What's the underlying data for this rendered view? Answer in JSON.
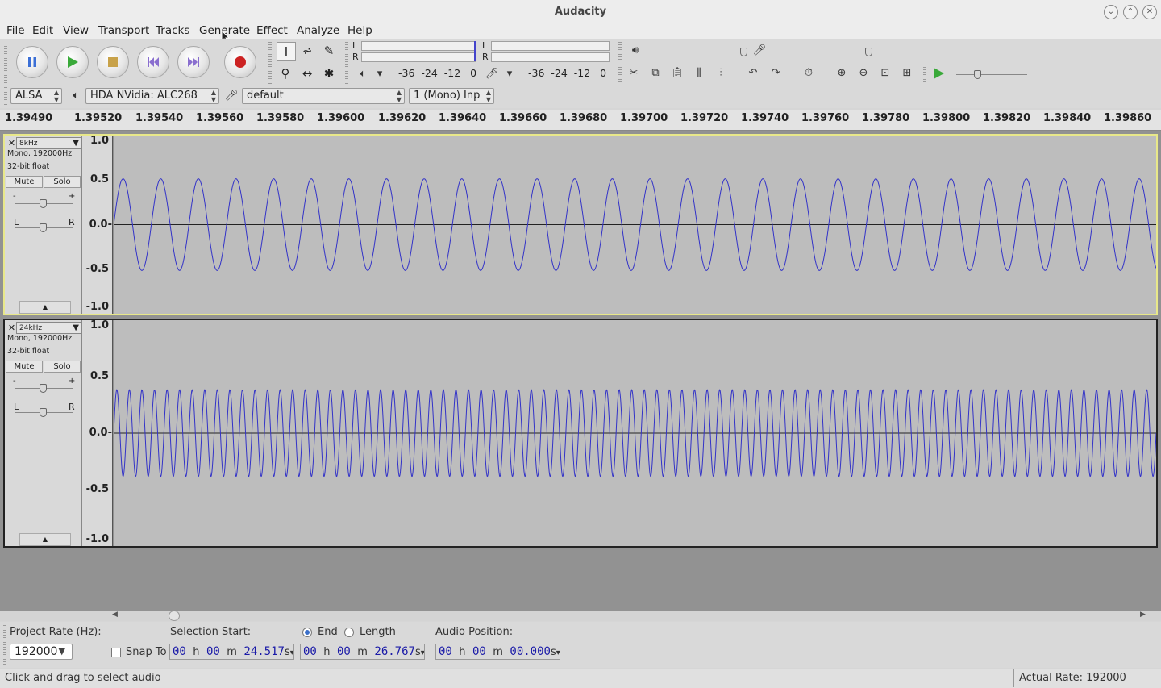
{
  "window": {
    "title": "Audacity"
  },
  "menu": [
    "File",
    "Edit",
    "View",
    "Transport",
    "Tracks",
    "Generate",
    "Effect",
    "Analyze",
    "Help"
  ],
  "transport": {
    "pause": "pause-icon",
    "play": "play-icon",
    "stop": "stop-icon",
    "skip_start": "skip-start-icon",
    "skip_end": "skip-end-icon",
    "record": "record-icon"
  },
  "meters": {
    "record_L": "L",
    "record_R": "R",
    "play_L": "L",
    "play_R": "R",
    "scale_play": "-36  -24  -12   0",
    "scale_record": "-36  -24  -12   0"
  },
  "device": {
    "host": "ALSA",
    "playback_device": "HDA NVidia: ALC268",
    "recording_device": "default",
    "channels": "1 (Mono) Inp"
  },
  "ruler": {
    "ticks": [
      "1.39490",
      "1.39520",
      "1.39540",
      "1.39560",
      "1.39580",
      "1.39600",
      "1.39620",
      "1.39640",
      "1.39660",
      "1.39680",
      "1.39700",
      "1.39720",
      "1.39740",
      "1.39760",
      "1.39780",
      "1.39800",
      "1.39820",
      "1.39840",
      "1.39860"
    ]
  },
  "tracks": [
    {
      "name": "8kHz",
      "format": "Mono, 192000Hz",
      "bits": "32-bit float",
      "mute": "Mute",
      "solo": "Solo",
      "gain_min": "-",
      "gain_max": "+",
      "pan_left": "L",
      "pan_right": "R",
      "scale": [
        "1.0",
        "0.5",
        "0.0-",
        "-0.5",
        "-1.0"
      ]
    },
    {
      "name": "24kHz",
      "format": "Mono, 192000Hz",
      "bits": "32-bit float",
      "mute": "Mute",
      "solo": "Solo",
      "gain_min": "-",
      "gain_max": "+",
      "pan_left": "L",
      "pan_right": "R",
      "scale": [
        "1.0",
        "0.5",
        "0.0-",
        "-0.5",
        "-1.0"
      ]
    }
  ],
  "selection": {
    "project_rate_label": "Project Rate (Hz):",
    "project_rate": "192000",
    "snap_label": "Snap To",
    "selection_start_label": "Selection Start:",
    "end_label": "End",
    "length_label": "Length",
    "audio_position_label": "Audio Position:",
    "start": {
      "h": "00",
      "m": "00",
      "s": "24.517"
    },
    "end": {
      "h": "00",
      "m": "00",
      "s": "26.767"
    },
    "position": {
      "h": "00",
      "m": "00",
      "s": "00.000"
    },
    "unit_h": "h",
    "unit_m": "m",
    "unit_s": "s"
  },
  "status": {
    "message": "Click and drag to select audio",
    "actual_rate": "Actual Rate: 192000"
  },
  "colors": {
    "waveform": "#3232c8",
    "accent": "#3a6fc9"
  }
}
